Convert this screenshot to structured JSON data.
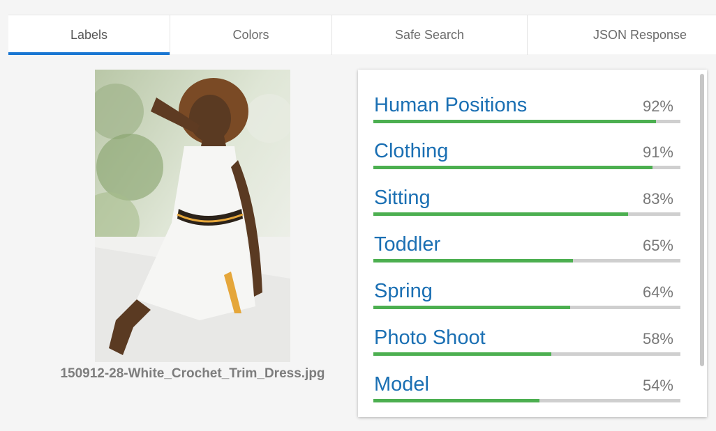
{
  "tabs": [
    {
      "label": "Labels",
      "active": true
    },
    {
      "label": "Colors",
      "active": false
    },
    {
      "label": "Safe Search",
      "active": false
    },
    {
      "label": "JSON Response",
      "active": false
    }
  ],
  "image": {
    "filename": "150912-28-White_Crochet_Trim_Dress.jpg"
  },
  "labels": [
    {
      "name": "Human Positions",
      "percent": "92%",
      "score": 0.92
    },
    {
      "name": "Clothing",
      "percent": "91%",
      "score": 0.91
    },
    {
      "name": "Sitting",
      "percent": "83%",
      "score": 0.83
    },
    {
      "name": "Toddler",
      "percent": "65%",
      "score": 0.65
    },
    {
      "name": "Spring",
      "percent": "64%",
      "score": 0.64
    },
    {
      "name": "Photo Shoot",
      "percent": "58%",
      "score": 0.58
    },
    {
      "name": "Model",
      "percent": "54%",
      "score": 0.54
    }
  ],
  "colors": {
    "accent": "#1976d2",
    "label_text": "#1a6fb3",
    "bar_fill": "#4caf50",
    "bar_track": "#cfcfcf"
  }
}
